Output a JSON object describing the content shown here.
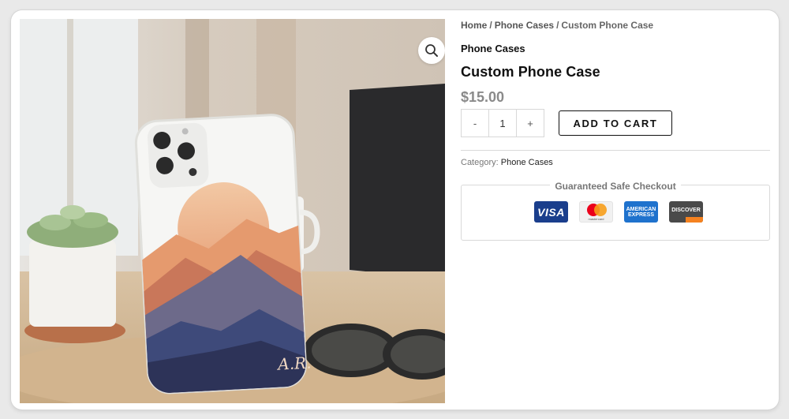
{
  "breadcrumb": {
    "home": "Home",
    "separator": "/",
    "category": "Phone Cases",
    "current": "Custom Phone Case"
  },
  "product": {
    "category_heading": "Phone Cases",
    "title": "Custom Phone Case",
    "price": "$15.00",
    "quantity": "1",
    "minus_label": "-",
    "plus_label": "+",
    "add_to_cart_label": "ADD TO CART",
    "monogram": "A.R."
  },
  "meta": {
    "category_label": "Category:",
    "category_value": "Phone Cases"
  },
  "checkout": {
    "heading": "Guaranteed Safe Checkout",
    "cards": {
      "visa": "VISA",
      "mastercard": "mastercard",
      "amex_line1": "AMERICAN",
      "amex_line2": "EXPRESS",
      "discover": "DISCOVER"
    }
  },
  "icons": {
    "zoom": "magnifier-icon"
  },
  "colors": {
    "price": "#8a8a8a",
    "visa": "#1a3e8c",
    "amex": "#1f72cd",
    "discover_accent": "#f58220"
  }
}
